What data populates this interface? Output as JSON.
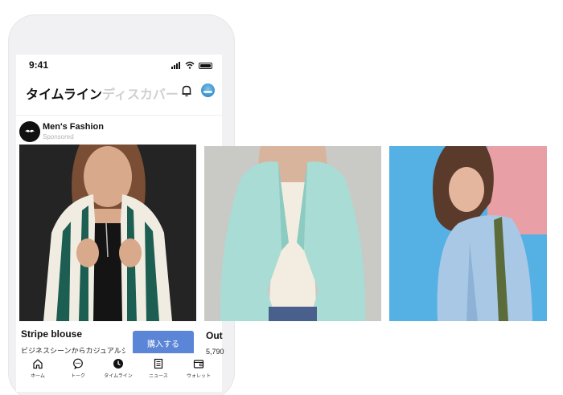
{
  "status_bar": {
    "time": "9:41"
  },
  "header": {
    "tab_timeline": "タイムライン",
    "tab_discover": "ディスカバー"
  },
  "post": {
    "brand_name": "Men's Fashion",
    "sponsored": "Sponsored",
    "avatar_text": "Men's Fashion"
  },
  "carousel": [
    {
      "title": "Stripe blouse",
      "description": "ビジネスシーンからカジュアルシ...",
      "button": "購入する"
    },
    {
      "title": "Out",
      "price": "5,790"
    }
  ],
  "nav": [
    {
      "label": "ホーム",
      "icon": "home-icon"
    },
    {
      "label": "トーク",
      "icon": "chat-icon"
    },
    {
      "label": "タイムライン",
      "icon": "clock-icon"
    },
    {
      "label": "ニュース",
      "icon": "news-icon"
    },
    {
      "label": "ウォレット",
      "icon": "wallet-icon"
    }
  ],
  "colors": {
    "buy_button": "#5b85d6",
    "discover_tab": "#cfd0d3",
    "photo3_bg": "#55b0e4"
  }
}
